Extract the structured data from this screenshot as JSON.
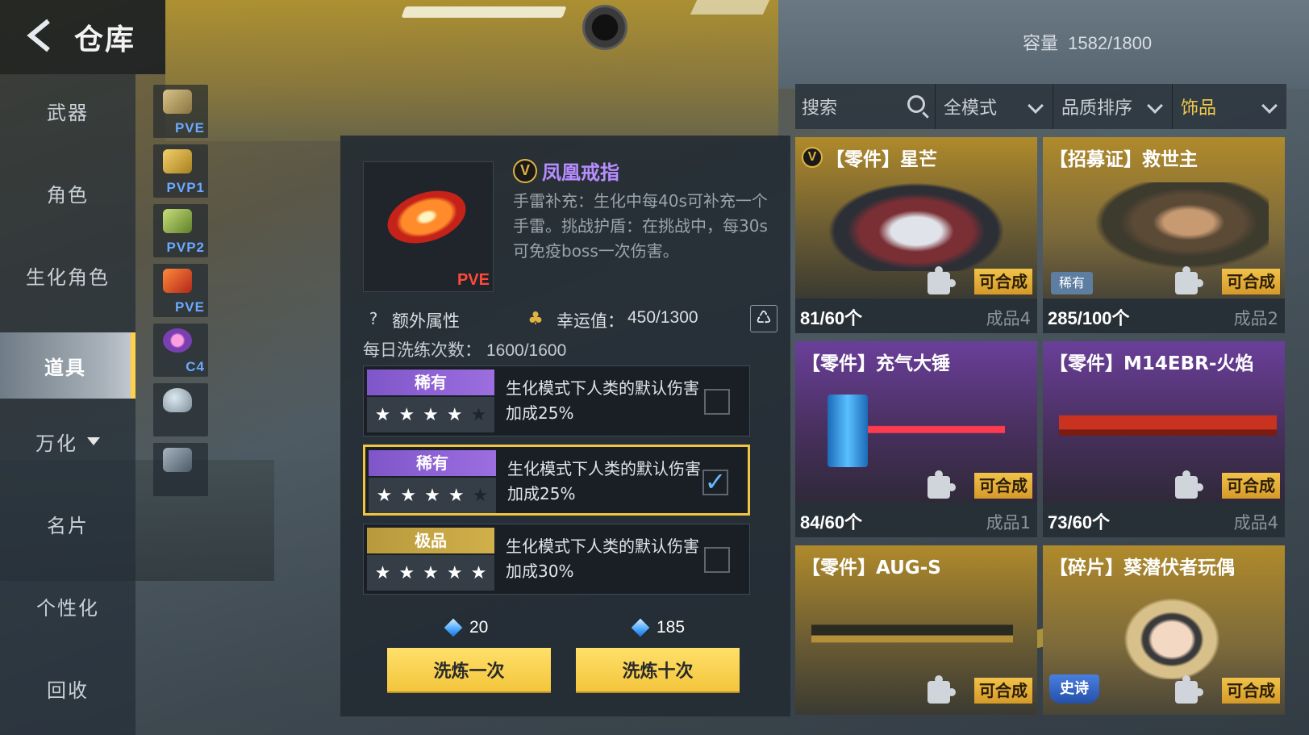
{
  "header": {
    "title": "仓库",
    "capacity_label": "容量",
    "capacity_value": "1582/1800"
  },
  "sidebar": {
    "items": [
      {
        "label": "武器"
      },
      {
        "label": "角色"
      },
      {
        "label": "生化角色"
      },
      {
        "label": "道具",
        "active": true
      },
      {
        "label": "万化"
      },
      {
        "label": "名片"
      },
      {
        "label": "个性化"
      },
      {
        "label": "回收"
      }
    ]
  },
  "thumbs": [
    {
      "tag": "PVE"
    },
    {
      "tag": "PVP1"
    },
    {
      "tag": "PVP2"
    },
    {
      "tag": "PVE"
    },
    {
      "tag": "C4"
    },
    {
      "tag": ""
    },
    {
      "tag": ""
    }
  ],
  "detail": {
    "name": "凤凰戒指",
    "badge": "V",
    "image_tag": "PVE",
    "desc": "手雷补充：生化中每40s可补充一个手雷。挑战护盾：在挑战中，每30s可免疫boss一次伤害。",
    "extra_label": "额外属性",
    "luck_label": "幸运值：",
    "luck_value": "450/1300",
    "daily_label": "每日洗练次数：",
    "daily_value": "1600/1600",
    "options": [
      {
        "grade": "稀有",
        "desc": "生化模式下人类的默认伤害加成25%",
        "stars": 4,
        "checked": false
      },
      {
        "grade": "稀有",
        "desc": "生化模式下人类的默认伤害加成25%",
        "stars": 4,
        "checked": true
      },
      {
        "grade": "极品",
        "desc": "生化模式下人类的默认伤害加成30%",
        "stars": 5,
        "checked": false
      }
    ],
    "cost_once": "20",
    "cost_ten": "185",
    "btn_once": "洗炼一次",
    "btn_ten": "洗炼十次"
  },
  "filters": {
    "search_placeholder": "搜索",
    "mode": "全模式",
    "sort": "品质排序",
    "category": "饰品"
  },
  "cards": [
    {
      "title": "【零件】星芒",
      "v": true,
      "count": "81/60个",
      "made": "成品4",
      "craft": "可合成"
    },
    {
      "title": "【招募证】救世主",
      "count": "285/100个",
      "made": "成品2",
      "craft": "可合成",
      "rarity": "稀有"
    },
    {
      "title": "【零件】充气大锤",
      "count": "84/60个",
      "made": "成品1",
      "craft": "可合成"
    },
    {
      "title": "【零件】M14EBR-火焰",
      "count": "73/60个",
      "made": "成品4",
      "craft": "可合成"
    },
    {
      "title": "【零件】AUG-S",
      "craft": "可合成"
    },
    {
      "title": "【碎片】葵潜伏者玩偶",
      "craft": "可合成",
      "rarity": "史诗"
    }
  ],
  "colors": {
    "accent_gold": "#f3c53c",
    "rare_purple": "#8b5fd6",
    "name_purple": "#b78dff",
    "check_blue": "#69b6ff"
  }
}
